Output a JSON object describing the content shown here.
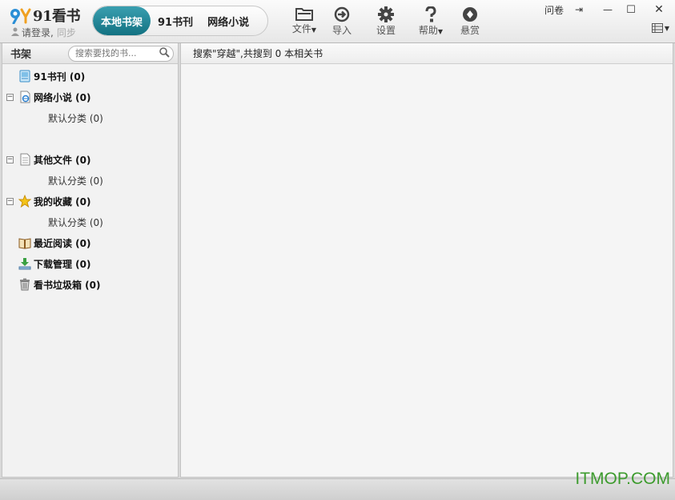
{
  "app": {
    "logo_text": "91看书",
    "login_prompt": "请登录,",
    "sync_label": "同步"
  },
  "tabs": [
    {
      "label": "本地书架",
      "active": true
    },
    {
      "label": "91书刊",
      "active": false
    },
    {
      "label": "网络小说",
      "active": false
    }
  ],
  "toolbar": {
    "file": "文件",
    "import": "导入",
    "settings": "设置",
    "help": "帮助",
    "reward": "悬赏"
  },
  "window": {
    "survey": "问卷",
    "pin_icon": "⇥",
    "minimize_icon": "—",
    "maximize_icon": "☐",
    "close_icon": "✕"
  },
  "sidebar": {
    "title": "书架",
    "search_placeholder": "搜索要找的书...",
    "items": [
      {
        "label": "91书刊 (0)",
        "icon": "magazine-icon"
      },
      {
        "label": "网络小说 (0)",
        "icon": "web-doc-icon",
        "expanded": true,
        "child": "默认分类 (0)"
      },
      {
        "label": "其他文件 (0)",
        "icon": "document-icon",
        "expanded": true,
        "child": "默认分类 (0)"
      },
      {
        "label": "我的收藏 (0)",
        "icon": "star-icon",
        "expanded": true,
        "child": "默认分类 (0)"
      },
      {
        "label": "最近阅读 (0)",
        "icon": "open-book-icon"
      },
      {
        "label": "下载管理 (0)",
        "icon": "download-icon"
      },
      {
        "label": "看书垃圾箱 (0)",
        "icon": "trash-icon"
      }
    ]
  },
  "main": {
    "search_result": "搜索\"穿越\",共搜到 0 本相关书"
  },
  "watermark": "ITMOP.COM",
  "colors": {
    "accent": "#137282",
    "watermark": "#3d9b2e"
  }
}
